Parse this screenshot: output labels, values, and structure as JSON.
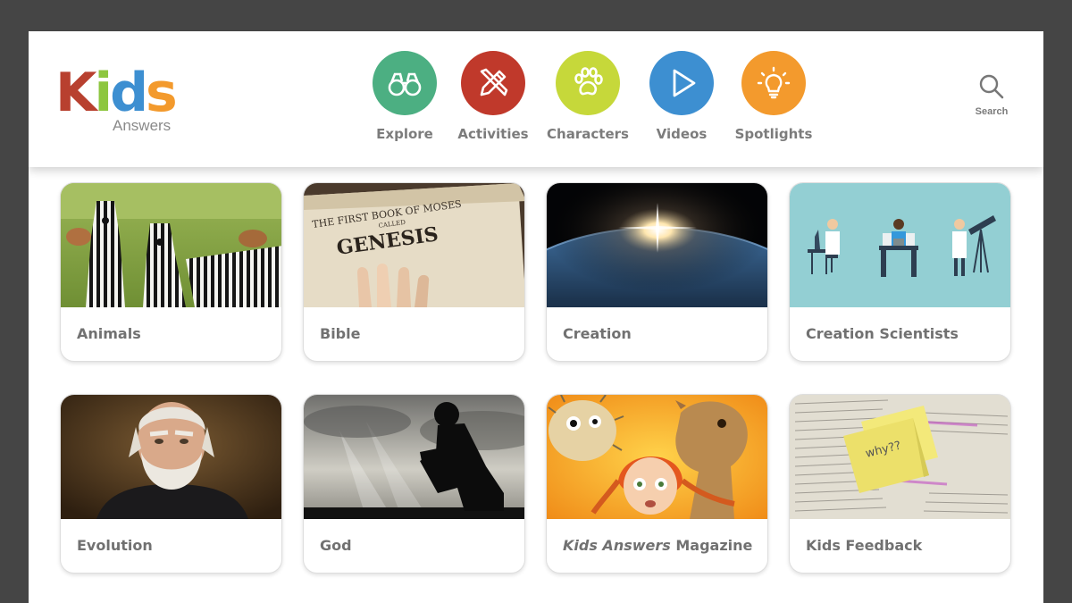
{
  "logo": {
    "letters": [
      "K",
      "i",
      "d",
      "s"
    ],
    "subtitle": "Answers",
    "colors": {
      "k": "#b8402f",
      "i": "#8dc63f",
      "d": "#3d8fd1",
      "s": "#f39a2d"
    }
  },
  "nav": {
    "items": [
      {
        "label": "Explore",
        "icon": "binoculars-icon",
        "color": "#4caf82"
      },
      {
        "label": "Activities",
        "icon": "pencil-ruler-icon",
        "color": "#c0392b"
      },
      {
        "label": "Characters",
        "icon": "paw-icon",
        "color": "#c6d83a"
      },
      {
        "label": "Videos",
        "icon": "play-icon",
        "color": "#3d8fd1"
      },
      {
        "label": "Spotlights",
        "icon": "lightbulb-icon",
        "color": "#f39a2d"
      }
    ]
  },
  "search": {
    "label": "Search",
    "icon": "search-icon"
  },
  "cards": [
    {
      "label": "Animals",
      "image": "zebras"
    },
    {
      "label": "Bible",
      "image": "genesis-book",
      "image_text": [
        "THE FIRST BOOK OF MOSES",
        "CALLED",
        "GENESIS"
      ]
    },
    {
      "label": "Creation",
      "image": "earth-sunrise"
    },
    {
      "label": "Creation Scientists",
      "image": "scientists-illustration"
    },
    {
      "label": "Evolution",
      "image": "darwin-portrait"
    },
    {
      "label": "God",
      "image": "praying-silhouette"
    },
    {
      "label_italic": "Kids Answers",
      "label_rest": " Magazine",
      "image": "magazine-girl-camel"
    },
    {
      "label": "Kids Feedback",
      "image": "sticky-note-bible",
      "image_text": [
        "why??"
      ]
    }
  ]
}
